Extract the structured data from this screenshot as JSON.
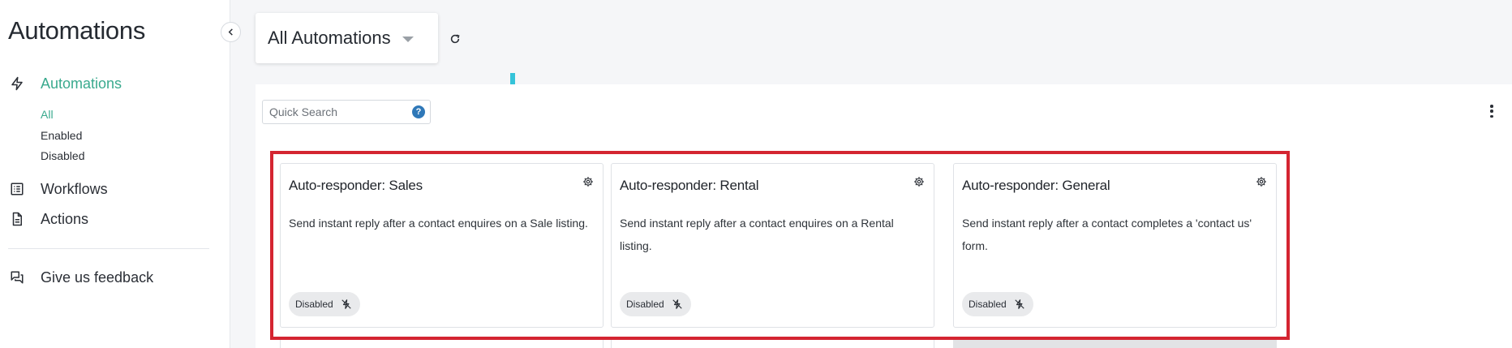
{
  "sidebar": {
    "title": "Automations",
    "nav": [
      {
        "label": "Automations",
        "icon": "lightning-icon",
        "active": true
      },
      {
        "label": "Workflows",
        "icon": "list-icon",
        "active": false
      },
      {
        "label": "Actions",
        "icon": "document-icon",
        "active": false
      }
    ],
    "subnav": [
      {
        "label": "All",
        "active": true
      },
      {
        "label": "Enabled",
        "active": false
      },
      {
        "label": "Disabled",
        "active": false
      }
    ],
    "feedback": {
      "label": "Give us feedback",
      "icon": "feedback-icon"
    }
  },
  "header": {
    "view_title": "All Automations"
  },
  "search": {
    "placeholder": "Quick Search",
    "help": "?"
  },
  "cards": [
    {
      "title": "Auto-responder: Sales",
      "description": "Send instant reply after a contact enquires on a Sale listing.",
      "status": "Disabled"
    },
    {
      "title": "Auto-responder: Rental",
      "description": "Send instant reply after a contact enquires on a Rental listing.",
      "status": "Disabled"
    },
    {
      "title": "Auto-responder: General",
      "description": "Send instant reply after a contact completes a 'contact us' form.",
      "status": "Disabled"
    }
  ],
  "colors": {
    "accent": "#3aaa8e",
    "highlight": "#d42531",
    "help": "#2f78b8",
    "marker": "#35c3d9"
  }
}
